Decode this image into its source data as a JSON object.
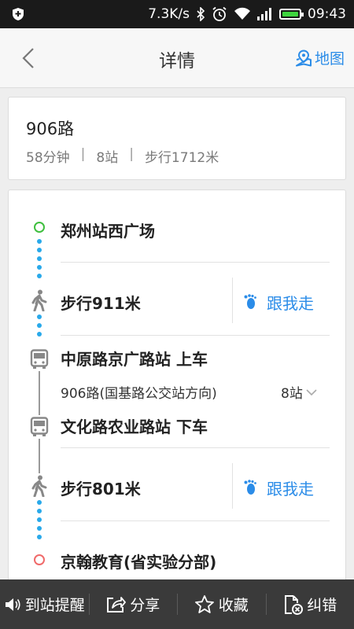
{
  "status_bar": {
    "speed": "7.3K/s",
    "time": "09:43"
  },
  "header": {
    "title": "详情",
    "map_label": "地图"
  },
  "summary": {
    "route_name": "906路",
    "duration": "58分钟",
    "stops": "8站",
    "walk": "步行1712米",
    "separator": "|"
  },
  "steps": {
    "start": "郑州站西广场",
    "walk1": "步行911米",
    "follow1": "跟我走",
    "board": "中原路京广路站 上车",
    "line_info": "906路(国基路公交站方向)",
    "stop_count": "8站",
    "alight": "文化路农业路站 下车",
    "walk2": "步行801米",
    "follow2": "跟我走",
    "end": "京翰教育(省实验分部)"
  },
  "bottom_bar": {
    "remind": "到站提醒",
    "share": "分享",
    "favorite": "收藏",
    "report": "纠错"
  },
  "colors": {
    "accent": "#2b8ce8",
    "walk_dots": "#29a9ea",
    "start_dot": "#3fbf3f",
    "end_dot": "#f06a6a",
    "bottom_bar": "#3a3a3a"
  }
}
